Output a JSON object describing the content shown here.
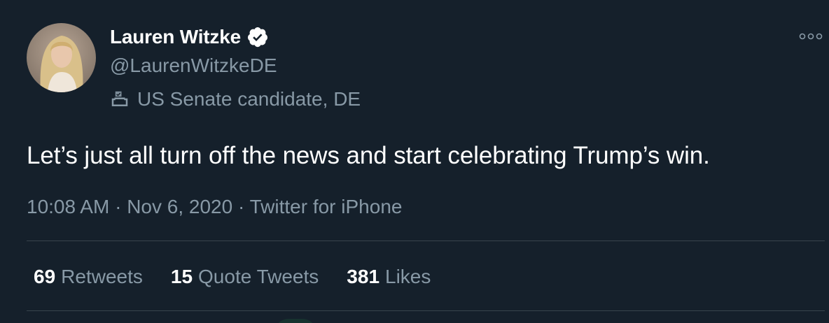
{
  "user": {
    "display_name": "Lauren Witzke",
    "handle": "@LaurenWitzkeDE",
    "label": "US Senate candidate, DE",
    "verified": true
  },
  "tweet": {
    "text": "Let’s just all turn off the news and start celebrating Trump’s win.",
    "time": "10:08 AM",
    "separator": " · ",
    "date": "Nov 6, 2020",
    "source": "Twitter for iPhone"
  },
  "stats": {
    "retweets_count": "69",
    "retweets_label": "Retweets",
    "quote_count": "15",
    "quote_label": "Quote Tweets",
    "likes_count": "381",
    "likes_label": "Likes"
  },
  "icons": {
    "verified": "verified-badge-icon",
    "label": "ballot-box-icon",
    "more": "more-options-icon"
  },
  "colors": {
    "background": "#15202b",
    "primary_text": "#ffffff",
    "secondary_text": "#8899a6",
    "divider": "#38444d"
  }
}
